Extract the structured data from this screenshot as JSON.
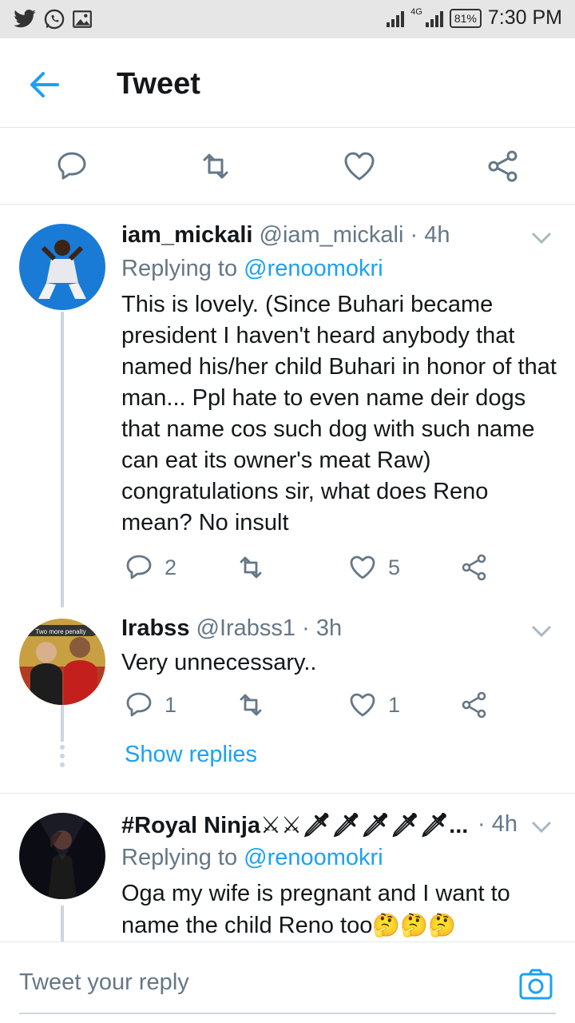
{
  "status_bar": {
    "left_icons": [
      "twitter-icon",
      "whatsapp-icon",
      "gallery-icon"
    ],
    "network": "4G",
    "battery": "81%",
    "time": "7:30 PM"
  },
  "header": {
    "title": "Tweet"
  },
  "tweets": [
    {
      "name": "iam_mickali",
      "handle": "@iam_mickali",
      "time": "4h",
      "replying_label": "Replying to",
      "replying_to": "@renoomokri",
      "text": "This is lovely. (Since Buhari became president I haven't heard anybody that named his/her child Buhari in honor of that man... Ppl hate to even name deir dogs that name cos such dog with such name can eat its owner's meat Raw) congratulations sir, what does Reno mean? No insult",
      "reply_count": "2",
      "like_count": "5"
    },
    {
      "name": "Irabss",
      "handle": "@Irabss1",
      "time": "3h",
      "avatar_caption": "Two more penalty",
      "text": "Very unnecessary..",
      "reply_count": "1",
      "like_count": "1",
      "show_replies": "Show replies"
    },
    {
      "name": "#Royal Ninja⚔⚔🗡🗡🗡🗡🗡...",
      "time": "4h",
      "replying_label": "Replying to",
      "replying_to": "@renoomokri",
      "text": "Oga my wife is pregnant and I want to name the child Reno too",
      "text_emoji": "🤔🤔🤔"
    }
  ],
  "composer": {
    "placeholder": "Tweet your reply"
  },
  "colors": {
    "accent": "#1da1f2",
    "secondary_text": "#657786",
    "divider": "#e1e8ed"
  }
}
